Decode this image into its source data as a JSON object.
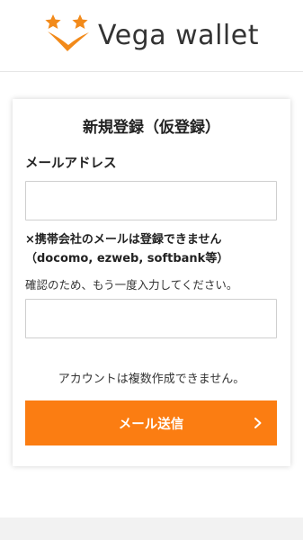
{
  "header": {
    "brand_name": "Vega wallet"
  },
  "form": {
    "title": "新規登録（仮登録）",
    "email_label": "メールアドレス",
    "email_value": "",
    "warning_line1": "×携帯会社のメールは登録できません",
    "warning_line2": "（docomo, ezweb, softbank等）",
    "confirm_hint": "確認のため、もう一度入力してください。",
    "confirm_value": "",
    "notice": "アカウントは複数作成できません。",
    "send_label": "メール送信"
  },
  "colors": {
    "accent": "#fb7d12",
    "logo_v": "#f28a1a"
  },
  "icons": {
    "logo": "vega-star-v-logo",
    "send_arrow": "chevron-right-icon"
  }
}
